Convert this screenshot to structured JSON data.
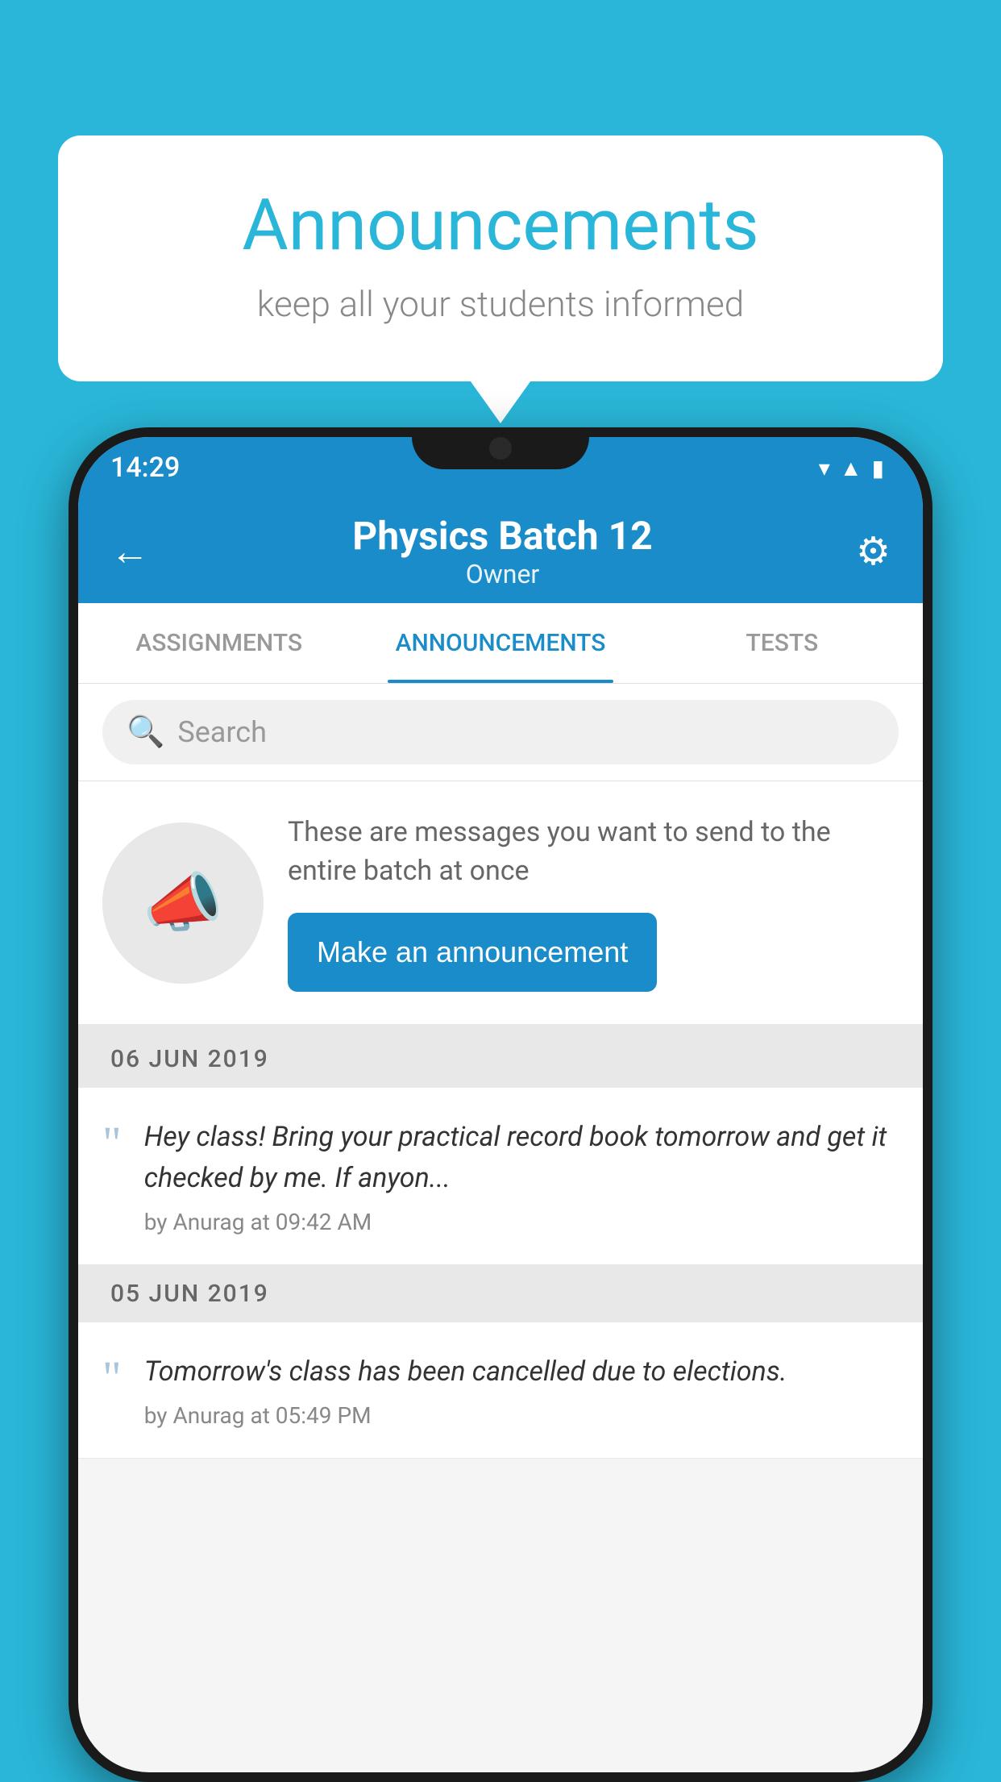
{
  "page": {
    "background_color": "#29b6d8"
  },
  "speech_bubble": {
    "title": "Announcements",
    "subtitle": "keep all your students informed"
  },
  "status_bar": {
    "time": "14:29"
  },
  "header": {
    "title": "Physics Batch 12",
    "subtitle": "Owner",
    "back_label": "←",
    "gear_label": "⚙"
  },
  "tabs": [
    {
      "label": "ASSIGNMENTS",
      "active": false
    },
    {
      "label": "ANNOUNCEMENTS",
      "active": true
    },
    {
      "label": "TESTS",
      "active": false
    }
  ],
  "search": {
    "placeholder": "Search"
  },
  "announcement_prompt": {
    "description": "These are messages you want to send to the entire batch at once",
    "button_label": "Make an announcement"
  },
  "announcements": [
    {
      "date": "06  JUN  2019",
      "text": "Hey class! Bring your practical record book tomorrow and get it checked by me. If anyon...",
      "meta": "by Anurag at 09:42 AM"
    },
    {
      "date": "05  JUN  2019",
      "text": "Tomorrow's class has been cancelled due to elections.",
      "meta": "by Anurag at 05:49 PM"
    }
  ]
}
